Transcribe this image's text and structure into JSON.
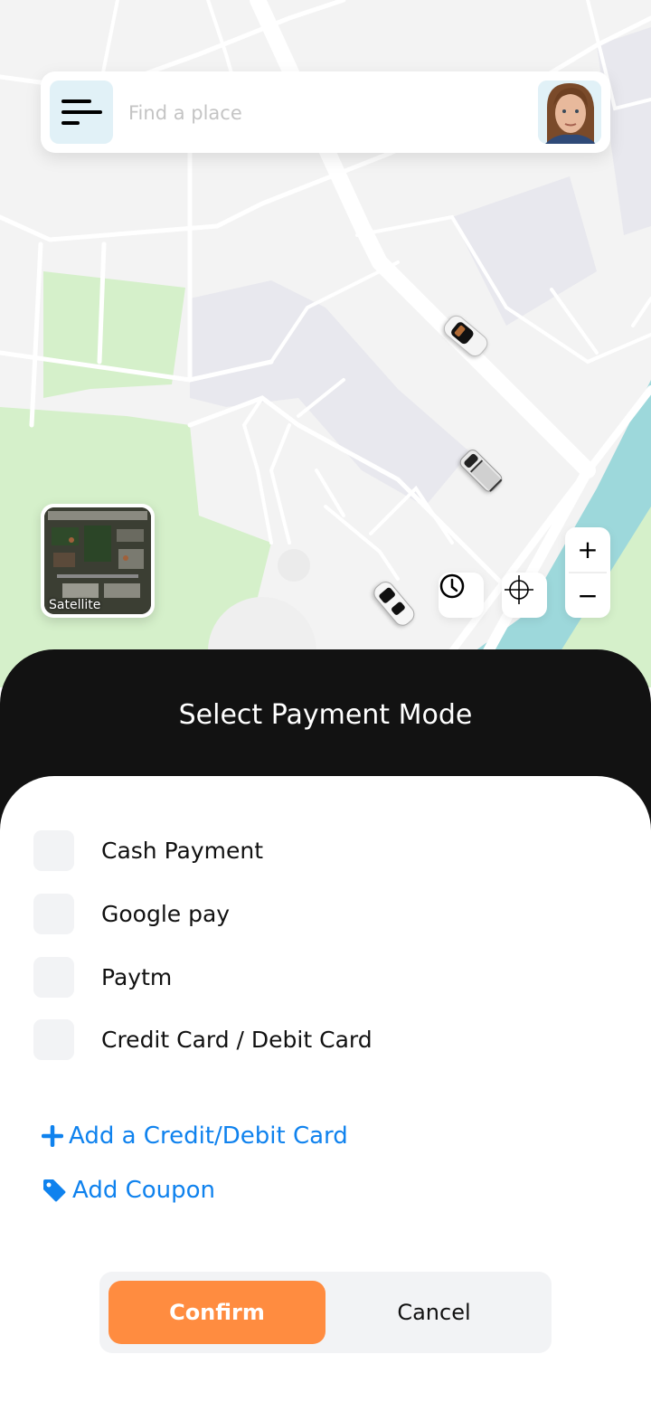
{
  "search": {
    "placeholder": "Find a place",
    "menu_icon": "menu-lines-icon",
    "avatar_icon": "user-avatar"
  },
  "map": {
    "satellite_label": "Satellite",
    "history_icon": "clock-icon",
    "locate_icon": "crosshair-icon",
    "zoom_in_label": "+",
    "zoom_out_label": "−",
    "vehicles": [
      "car-icon",
      "car-icon",
      "car-icon"
    ]
  },
  "sheet": {
    "title": "Select Payment Mode",
    "options": [
      {
        "label": "Cash Payment",
        "checked": false
      },
      {
        "label": "Google pay",
        "checked": false
      },
      {
        "label": "Paytm",
        "checked": false
      },
      {
        "label": "Credit Card / Debit Card",
        "checked": false
      }
    ],
    "add_card_label": "Add a Credit/Debit Card",
    "add_coupon_label": "Add Coupon"
  },
  "actions": {
    "confirm_label": "Confirm",
    "cancel_label": "Cancel"
  },
  "colors": {
    "accent": "#ff8c40",
    "link": "#0f82ee",
    "sheet_header": "#121212"
  }
}
